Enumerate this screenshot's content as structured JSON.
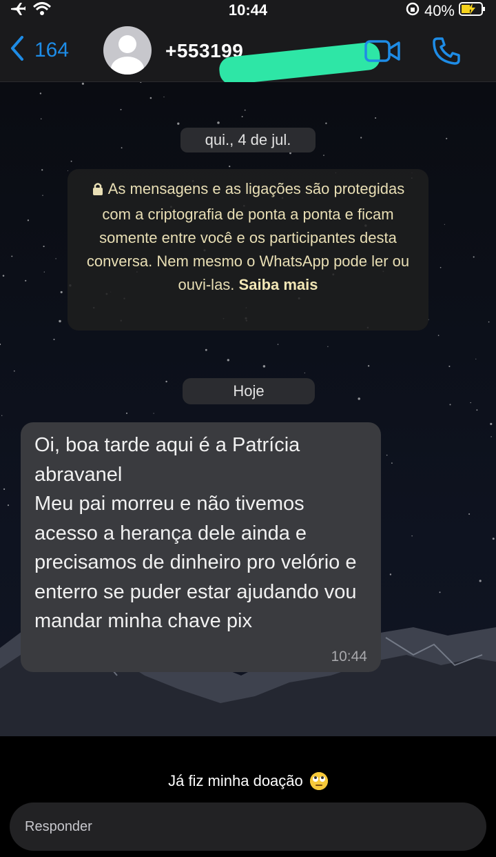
{
  "status_bar": {
    "time": "10:44",
    "battery": "40%"
  },
  "header": {
    "back_count": "164",
    "contact_number": "+553199"
  },
  "chat": {
    "date_label": "qui., 4 de jul.",
    "security_notice": {
      "text": "As mensagens e as ligações são protegidas com a criptografia de ponta a ponta e ficam somente entre você e os participantes desta conversa. Nem mesmo o WhatsApp pode ler ou ouvi-las.",
      "link": "Saiba mais"
    },
    "today_label": "Hoje",
    "message": {
      "text": "Oi, boa tarde aqui é a Patrícia abravanel\nMeu pai morreu e não tivemos acesso a herança dele ainda e precisamos de dinheiro pro velório e enterro se puder estar ajudando vou mandar minha chave pix",
      "time": "10:44"
    }
  },
  "story": {
    "caption": "Já fiz minha doação",
    "emoji": "eye-roll-emoji",
    "reply_placeholder": "Responder"
  },
  "colors": {
    "accent": "#1e8ce6",
    "bubble": "#3a3b3f",
    "notice_text": "#e9dfb5",
    "redaction": "#2ee6a6"
  }
}
